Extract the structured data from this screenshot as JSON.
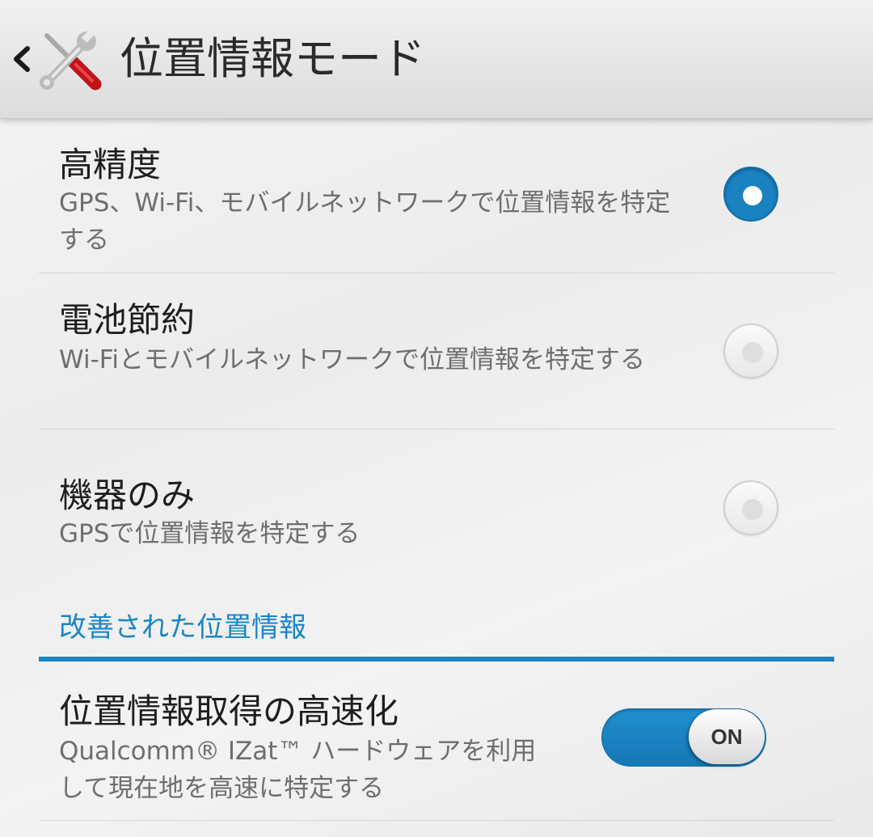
{
  "header": {
    "back_icon": "chevron-left-icon",
    "app_icon": "wrench-screwdriver-icon",
    "title": "位置情報モード"
  },
  "modes": [
    {
      "title": "高精度",
      "summary": "GPS、Wi-Fi、モバイルネットワークで位置情報を特定する",
      "selected": true
    },
    {
      "title": "電池節約",
      "summary": "Wi-Fiとモバイルネットワークで位置情報を特定する",
      "selected": false
    },
    {
      "title": "機器のみ",
      "summary": "GPSで位置情報を特定する",
      "selected": false
    }
  ],
  "section": {
    "header": "改善された位置情報"
  },
  "fast_location": {
    "title": "位置情報取得の高速化",
    "summary": "Qualcomm® IZat™ ハードウェアを利用して現在地を高速に特定する",
    "toggle_label": "ON",
    "enabled": true
  },
  "colors": {
    "accent": "#1a86c4",
    "radio_on": "#1a82c0"
  }
}
